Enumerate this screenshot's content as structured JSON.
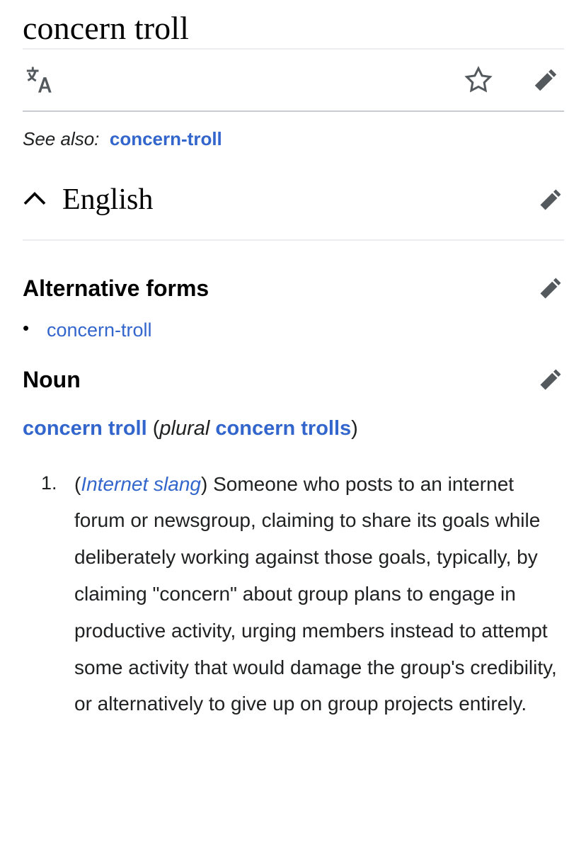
{
  "page": {
    "title": "concern troll"
  },
  "actions": {
    "language_icon": "translate-language-icon",
    "watch_icon": "star-outline-icon",
    "edit_icon": "pencil-edit-icon"
  },
  "see_also": {
    "label": "See also:",
    "link": "concern-troll"
  },
  "sections": {
    "language": {
      "name": "English",
      "collapse_icon": "chevron-up-icon",
      "edit_icon": "pencil-edit-icon"
    },
    "alternative_forms": {
      "heading": "Alternative forms",
      "edit_icon": "pencil-edit-icon",
      "items": [
        {
          "label": "concern-troll"
        }
      ]
    },
    "noun": {
      "heading": "Noun",
      "edit_icon": "pencil-edit-icon",
      "headword": {
        "term": "concern troll",
        "open_paren": "(",
        "grammar_label": "plural",
        "plural_form": "concern trolls",
        "close_paren": ")"
      },
      "definitions": [
        {
          "number": "1.",
          "open_paren": "(",
          "label": "Internet slang",
          "close_paren": ")",
          "text": " Someone who posts to an internet forum or newsgroup, claiming to share its goals while deliberately working against those goals, typically, by claiming \"concern\" about group plans to engage in productive activity, urging members instead to attempt some activity that would damage the group's credibility, or alternatively to give up on group projects entirely."
        }
      ]
    }
  },
  "colors": {
    "link_blue": "#3366cc",
    "text": "#202122",
    "icon_gray": "#54595d",
    "rule_light": "#eaecf0",
    "rule_strong": "#c8ccd1"
  }
}
